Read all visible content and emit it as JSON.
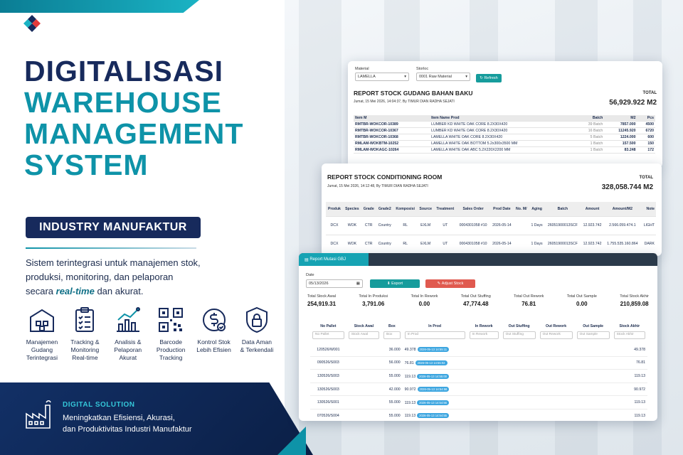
{
  "hero": {
    "line1": "DIGITALISASI",
    "line2": "WAREHOUSE",
    "line3": "MANAGEMENT",
    "line4": "SYSTEM"
  },
  "badge": "INDUSTRY MANUFAKTUR",
  "description": {
    "part1": "Sistem terintegrasi untuk manajemen stok,",
    "part2": "produksi, monitoring, dan pelaporan",
    "part3a": "secara ",
    "part3b": "real-time",
    "part3c": " dan akurat."
  },
  "features": [
    {
      "icon": "warehouse-icon",
      "l1": "Manajemen",
      "l2": "Gudang",
      "l3": "Terintegrasi"
    },
    {
      "icon": "clipboard-icon",
      "l1": "Tracking &",
      "l2": "Monitoring",
      "l3": "Real-time"
    },
    {
      "icon": "bar-chart-icon",
      "l1": "Analisis &",
      "l2": "Pelaporan",
      "l3": "Akurat"
    },
    {
      "icon": "qr-code-icon",
      "l1": "Barcode",
      "l2": "Production",
      "l3": "Tracking"
    },
    {
      "icon": "dollar-check-icon",
      "l1": "Kontrol Stok",
      "l2": "Lebih Efisien",
      "l3": ""
    },
    {
      "icon": "lock-shield-icon",
      "l1": "Data Aman",
      "l2": "& Terkendali",
      "l3": ""
    }
  ],
  "footer": {
    "title": "DIGITAL SOLUTION",
    "line1": "Meningkatkan Efisiensi, Akurasi,",
    "line2": "dan Produktivitas Industri Manufaktur"
  },
  "report1": {
    "material_label": "Material",
    "material_value": "LAMELLA",
    "storloc_label": "Storloc",
    "storloc_value": "0001 Raw Material",
    "refresh": "Refresh",
    "title": "REPORT STOCK GUDANG BAHAN BAKU",
    "subtitle": "Jumat, 15 Mei 2026, 14:04:37, By TIMUR DIAN RADHA SEJATI",
    "total_label": "TOTAL",
    "total_value": "56,929.922 M2",
    "headers": [
      "Item M",
      "Item Name Prod",
      "Batch",
      "M2",
      "Pcs"
    ],
    "rows": [
      [
        "RMTBR-WOKCOR-10389",
        "LUMBER KD WHITE OAK CORE 8.2X30X420",
        "39 Batch",
        "7857.000",
        "4500"
      ],
      [
        "RMTBR-WOKCOR-10367",
        "LUMBER KD WHITE OAK CORE 8.2X30X420",
        "16 Batch",
        "11245.920",
        "6720"
      ],
      [
        "RMTBR-WOKCOR-10368",
        "LAMELLA WHITE OAK CORE 8.2X30X420",
        "5 Batch",
        "1224.000",
        "600"
      ],
      [
        "RMLAM-WOKBTM-10252",
        "LAMELLA WHITE OAK BOTTOM 5.2x300x3500 MM",
        "1 Batch",
        "157.500",
        "150"
      ],
      [
        "RMLAM-WOKAGC-10264",
        "LAMELLA WHITE OAK ABC 5.2X220X2200 MM",
        "1 Batch",
        "83.248",
        "172"
      ]
    ]
  },
  "report2": {
    "title": "REPORT STOCK CONDITIONING ROOM",
    "subtitle": "Jumat, 15 Mei 2026, 14:12:48, By TIMUR DIAN RADHA SEJATI",
    "total_label": "TOTAL",
    "total_value": "328,058.744 M2",
    "headers": [
      "Produk",
      "Species",
      "Grade",
      "Grade2",
      "Komposisi",
      "Source",
      "Treatment",
      "Sales Order",
      "Prod Date",
      "No. M/",
      "Aging",
      "Batch",
      "Amount",
      "Amount/M2",
      "Note"
    ],
    "rows": [
      [
        "DCX",
        "WOK",
        "CTR",
        "Country",
        "RL",
        "EXLM",
        "UT",
        "0004301058 #10",
        "2026-05-14",
        "",
        "1 Days",
        "26051900013SCF",
        "12.923.742",
        "2.566.059.474.1",
        "LIGHT"
      ],
      [
        "DCX",
        "WOK",
        "CTR",
        "Country",
        "RL",
        "EXLM",
        "UT",
        "0004301058 #10",
        "2026-05-14",
        "",
        "1 Days",
        "26051900013SCF",
        "12.923.742",
        "1.755.535.160.864",
        "DARK"
      ]
    ]
  },
  "report3": {
    "tab": "Report Mutasi GBJ",
    "date_label": "Date",
    "date_value": "05/13/2026",
    "export": "Export",
    "adjust": "Adjust Stock",
    "summary": [
      {
        "label": "Total Stock Awal",
        "value": "254,919.31"
      },
      {
        "label": "Total In Produksi",
        "value": "3,791.06"
      },
      {
        "label": "Total In Rework",
        "value": "0.00"
      },
      {
        "label": "Total Out Stuffing",
        "value": "47,774.48"
      },
      {
        "label": "Total Out Rework",
        "value": "76.81"
      },
      {
        "label": "Total Out Sample",
        "value": "0.00"
      },
      {
        "label": "Total Stock Akhir",
        "value": "210,859.08"
      }
    ],
    "headers": [
      "No Pallet",
      "Stock Awal",
      "Box",
      "In Prod",
      "In Rework",
      "Out Stuffing",
      "Out Rework",
      "Out Sample",
      "Stock Akhir"
    ],
    "filters": [
      "No Pallet",
      "Stock Awal",
      "Box",
      "In Prod",
      "In Rework",
      "Out Stuffing",
      "Out Rework",
      "Out Sample",
      "Stock Akhir"
    ],
    "rows": [
      [
        "120526/W001",
        "",
        "36.000",
        "49.378",
        "2026-05-13 14:55:11",
        "",
        "",
        "",
        "",
        "49.378"
      ],
      [
        "090526/S003",
        "",
        "56.000",
        "76.81",
        "2026-05-13 14:55:02",
        "",
        "",
        "",
        "",
        "76.81"
      ],
      [
        "130526/S003",
        "",
        "55.000",
        "119.13",
        "2026-05-13 14:55:00",
        "",
        "",
        "",
        "",
        "119.13"
      ],
      [
        "130526/S003",
        "",
        "42.000",
        "90.972",
        "2026-05-13 14:54:58",
        "",
        "",
        "",
        "",
        "90.972"
      ],
      [
        "130526/S001",
        "",
        "55.000",
        "119.13",
        "2026-05-13 14:54:56",
        "",
        "",
        "",
        "",
        "119.13"
      ],
      [
        "070526/S004",
        "",
        "55.000",
        "119.13",
        "2026-05-13 14:54:55",
        "",
        "",
        "",
        "",
        "119.13"
      ]
    ]
  }
}
